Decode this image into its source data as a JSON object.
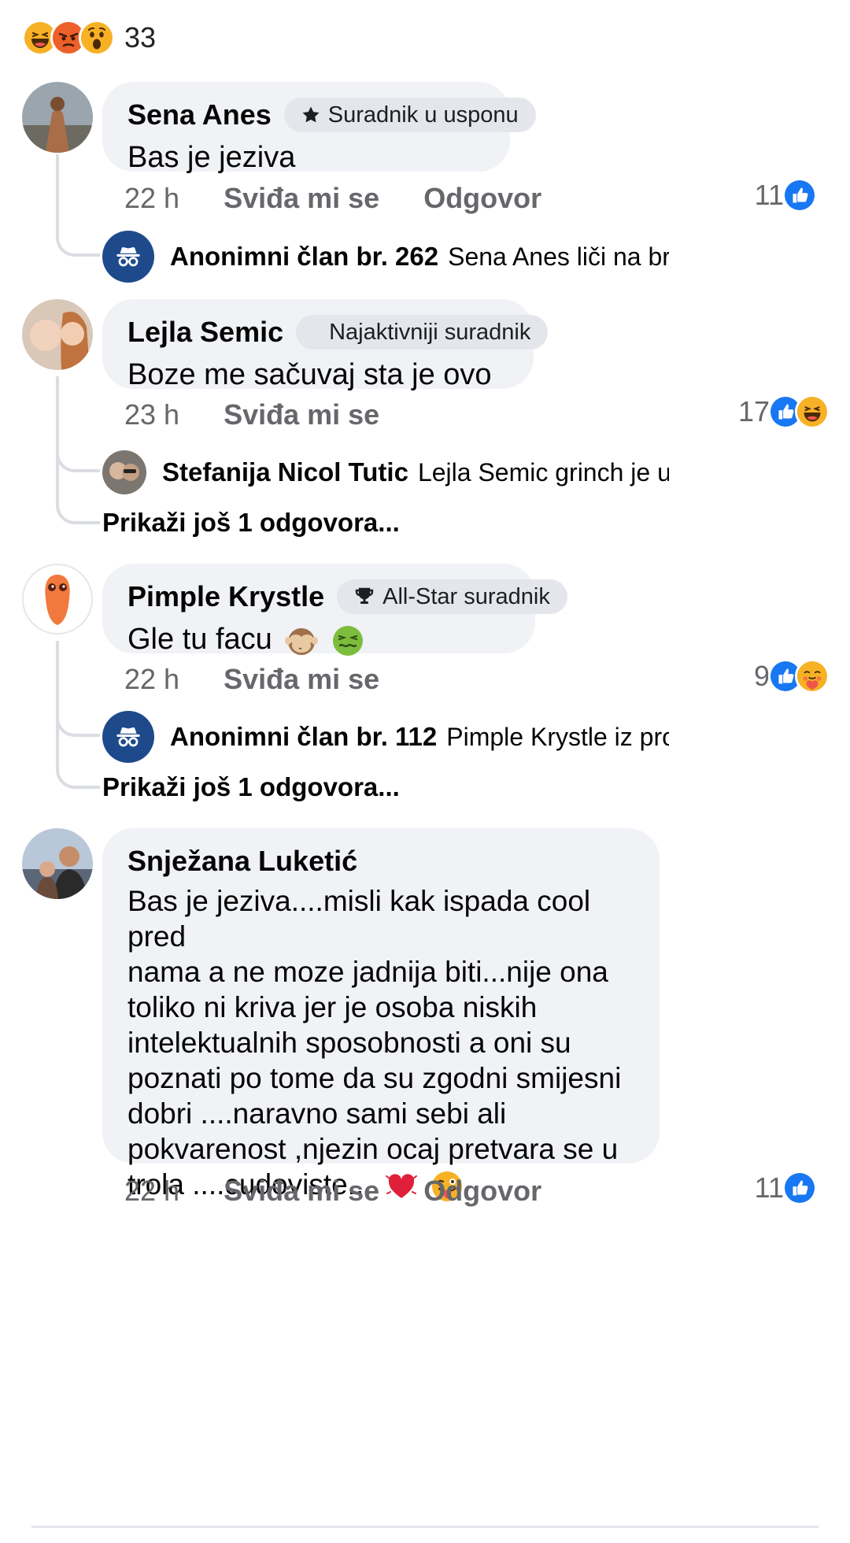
{
  "top_reactions": {
    "icons": [
      "haha-icon",
      "angry-icon",
      "wow-icon"
    ],
    "count": "33"
  },
  "comments": [
    {
      "author": "Sena Anes",
      "badge": "Suradnik u usponu",
      "badge_icon": "star-icon",
      "text": "Bas je jeziva",
      "time": "22 h",
      "like_label": "Sviđa mi se",
      "reply_label": "Odgovor",
      "reaction_count": "11",
      "reaction_icons": [
        "like-icon"
      ],
      "reply": {
        "author": "Anonimni član br. 262",
        "text": "Sena Anes liči na brati..."
      }
    },
    {
      "author": "Lejla Semic",
      "badge": "Najaktivniji suradnik",
      "text": "Boze me sačuvaj sta je ovo",
      "time": "23 h",
      "like_label": "Sviđa mi se",
      "reaction_count": "17",
      "reaction_icons": [
        "like-icon",
        "haha-icon"
      ],
      "reply": {
        "author": "Stefanija Nicol Tutic",
        "text": "Lejla Semic grinch je ukr..."
      },
      "more_replies": "Prikaži još 1 odgovora..."
    },
    {
      "author": "Pimple Krystle",
      "badge": "All-Star suradnik",
      "badge_icon": "trophy-icon",
      "text": "Gle tu facu",
      "text_emojis": [
        "see-no-evil-monkey-icon",
        "nauseated-face-icon"
      ],
      "time": "22 h",
      "like_label": "Sviđa mi se",
      "reaction_count": "9",
      "reaction_icons": [
        "like-icon",
        "care-icon"
      ],
      "reply": {
        "author": "Anonimni član br. 112",
        "text": "Pimple Krystle iz profil..."
      },
      "more_replies": "Prikaži još 1 odgovora..."
    },
    {
      "author": "Snježana Luketić",
      "text_lines": [
        "Bas je jeziva....misli kak ispada cool pred",
        "nama a ne moze jadnija biti...nije ona",
        "toliko ni kriva jer je osoba niskih",
        "intelektualnih sposobnosti a oni su",
        "poznati po tome da su zgodni smijesni",
        "dobri ....naravno sami sebi ali",
        "pokvarenost ,njezin ocaj pretvara se u",
        "trola ....cudoviste..."
      ],
      "text_emojis": [
        "beating-heart-icon",
        "winking-tongue-icon"
      ],
      "time": "22 h",
      "like_label": "Sviđa mi se",
      "reply_label": "Odgovor",
      "reaction_count": "11",
      "reaction_icons": [
        "like-icon"
      ]
    }
  ],
  "colors": {
    "like_blue": "#1877f2",
    "bubble": "#f0f2f5",
    "badge": "#e4e6eb",
    "meta_gray": "#65676b",
    "anon_blue": "#1e4a8c"
  }
}
